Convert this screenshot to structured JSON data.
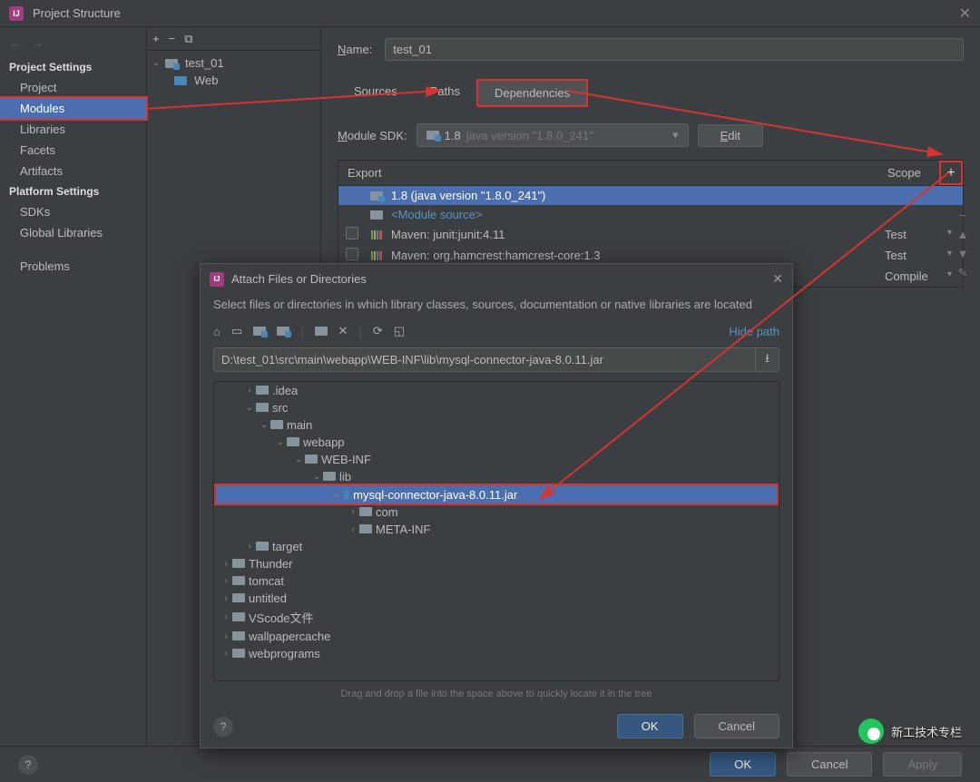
{
  "window": {
    "title": "Project Structure"
  },
  "nav": {
    "project_heading": "Project Settings",
    "platform_heading": "Platform Settings",
    "items_project": [
      "Project",
      "Modules",
      "Libraries",
      "Facets",
      "Artifacts"
    ],
    "items_platform": [
      "SDKs",
      "Global Libraries"
    ],
    "problems": "Problems"
  },
  "module_tree": {
    "root": "test_01",
    "child": "Web"
  },
  "form": {
    "name_label": "Name:",
    "name_value": "test_01",
    "tabs": [
      "Sources",
      "Paths",
      "Dependencies"
    ],
    "sdk_label": "Module SDK:",
    "sdk_value": "1.8",
    "sdk_detail": "java version \"1.8.0_241\"",
    "edit": "Edit"
  },
  "deps": {
    "header_export": "Export",
    "header_scope": "Scope",
    "rows": [
      {
        "text": "1.8 (java version \"1.8.0_241\")",
        "scope": "",
        "kind": "sdk",
        "selected": true
      },
      {
        "text": "<Module source>",
        "scope": "",
        "kind": "src"
      },
      {
        "text": "Maven: junit:junit:4.11",
        "scope": "Test",
        "kind": "lib",
        "cb": true
      },
      {
        "text": "Maven: org.hamcrest:hamcrest-core:1.3",
        "scope": "Test",
        "kind": "lib",
        "cb": true
      },
      {
        "text": "",
        "scope": "Compile",
        "kind": "lib",
        "cb": true
      }
    ]
  },
  "dialog": {
    "title": "Attach Files or Directories",
    "subtitle": "Select files or directories in which library classes, sources, documentation or native libraries are located",
    "hide_path": "Hide path",
    "path": "D:\\test_01\\src\\main\\webapp\\WEB-INF\\lib\\mysql-connector-java-8.0.11.jar",
    "tree": [
      {
        "indent": 1,
        "chev": "›",
        "name": ".idea"
      },
      {
        "indent": 1,
        "chev": "⌄",
        "name": "src"
      },
      {
        "indent": 2,
        "chev": "⌄",
        "name": "main"
      },
      {
        "indent": 3,
        "chev": "⌄",
        "name": "webapp"
      },
      {
        "indent": 4,
        "chev": "⌄",
        "name": "WEB-INF"
      },
      {
        "indent": 5,
        "chev": "⌄",
        "name": "lib"
      },
      {
        "indent": 6,
        "chev": "⌄",
        "name": "mysql-connector-java-8.0.11.jar",
        "jar": true,
        "selected": true
      },
      {
        "indent": 7,
        "chev": "›",
        "name": "com"
      },
      {
        "indent": 7,
        "chev": "›",
        "name": "META-INF"
      },
      {
        "indent": 1,
        "chev": "›",
        "name": "target"
      },
      {
        "indent": 0,
        "chev": "›",
        "name": "Thunder"
      },
      {
        "indent": 0,
        "chev": "›",
        "name": "tomcat"
      },
      {
        "indent": 0,
        "chev": "›",
        "name": "untitled"
      },
      {
        "indent": 0,
        "chev": "›",
        "name": "VScode文件"
      },
      {
        "indent": 0,
        "chev": "›",
        "name": "wallpapercache"
      },
      {
        "indent": 0,
        "chev": "›",
        "name": "webprograms"
      }
    ],
    "hint": "Drag and drop a file into the space above to quickly locate it in the tree",
    "ok": "OK",
    "cancel": "Cancel"
  },
  "bottom": {
    "ok": "OK",
    "cancel": "Cancel",
    "apply": "Apply"
  },
  "watermark": "新工技术专栏"
}
